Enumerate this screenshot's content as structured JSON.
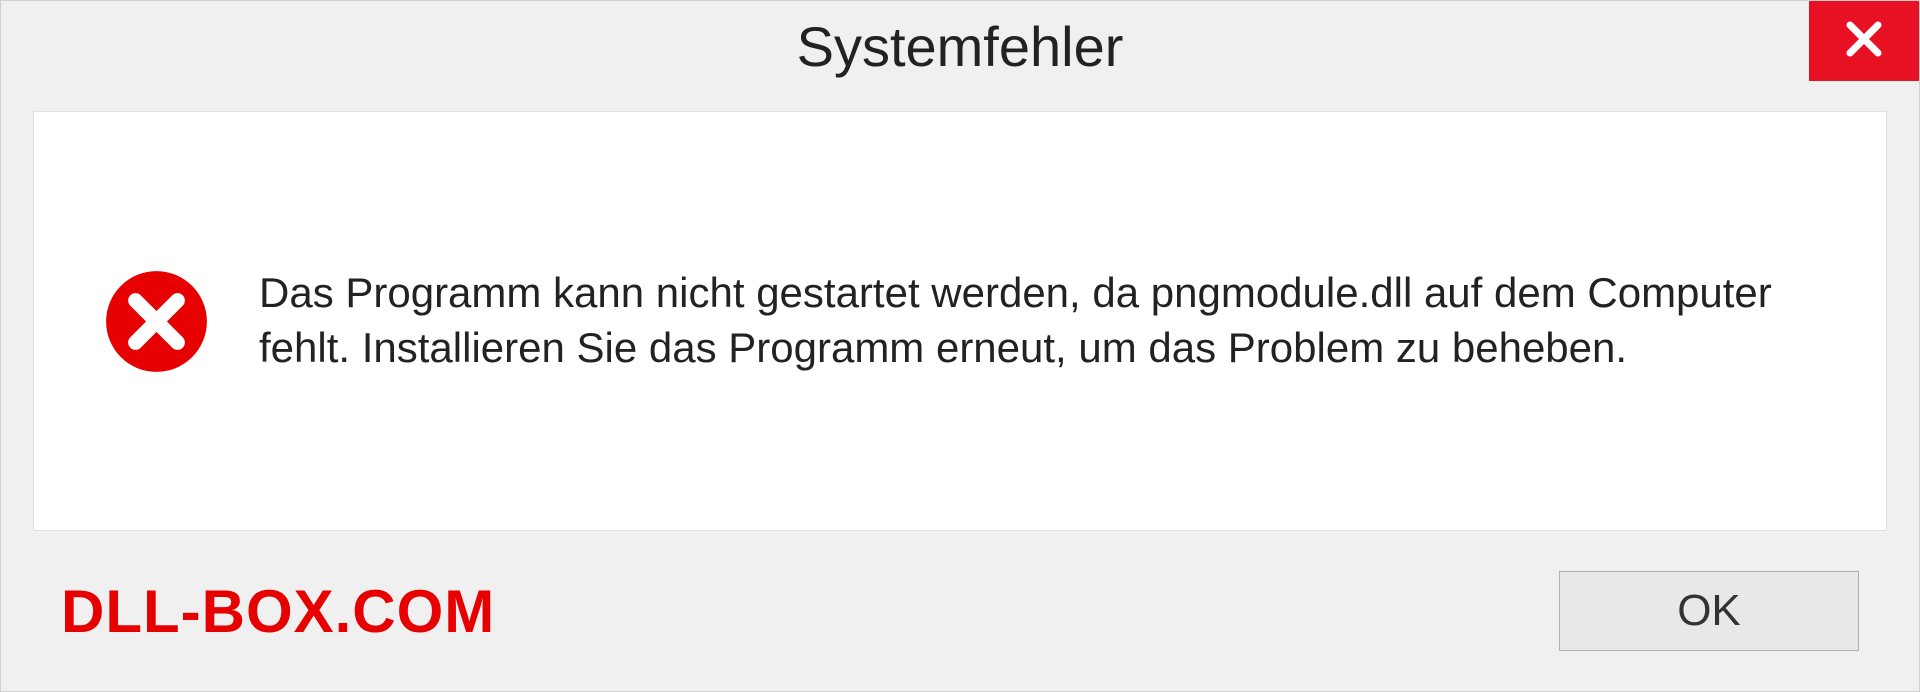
{
  "titlebar": {
    "title": "Systemfehler"
  },
  "dialog": {
    "message": "Das Programm kann nicht gestartet werden, da pngmodule.dll auf dem Computer fehlt. Installieren Sie das Programm erneut, um das Problem zu beheben."
  },
  "footer": {
    "watermark": "DLL-BOX.COM",
    "ok_label": "OK"
  }
}
